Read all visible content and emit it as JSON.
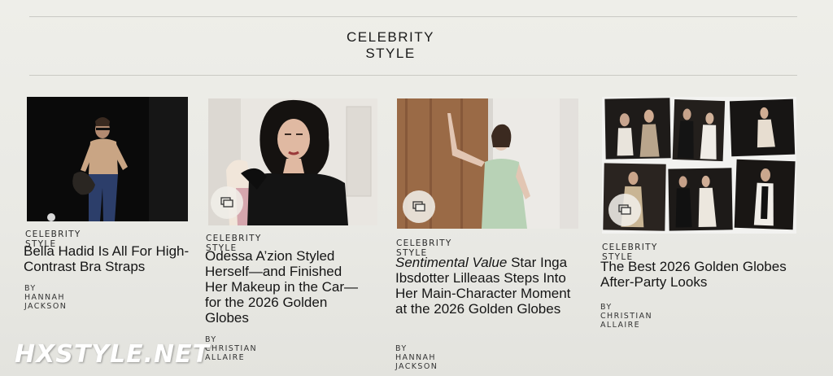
{
  "section": {
    "title_line1": "CELEBRITY",
    "title_line2": "STYLE"
  },
  "articles": [
    {
      "kicker": "CELEBRITY STYLE",
      "headline_italic": "",
      "headline": "Bella Hadid Is All For High-Contrast Bra Straps",
      "byline": "BY HANNAH JACKSON",
      "has_gallery_icon": false
    },
    {
      "kicker": "CELEBRITY STYLE",
      "headline_italic": "",
      "headline": "Odessa A’zion Styled Herself—and Finished Her Makeup in the Car—for the 2026 Golden Globes",
      "byline": "BY CHRISTIAN ALLAIRE",
      "has_gallery_icon": true
    },
    {
      "kicker": "CELEBRITY STYLE",
      "headline_italic": "Sentimental Value",
      "headline": " Star Inga Ibsdotter Lilleaas Steps Into Her Main-Character Moment at the 2026 Golden Globes",
      "byline": "BY HANNAH JACKSON",
      "has_gallery_icon": true
    },
    {
      "kicker": "CELEBRITY STYLE",
      "headline_italic": "",
      "headline": "The Best 2026 Golden Globes After-Party Looks",
      "byline": "BY CHRISTIAN ALLAIRE",
      "has_gallery_icon": true
    }
  ],
  "icons": {
    "gallery": "gallery-icon"
  },
  "watermark": "HXSTYLE.NET"
}
